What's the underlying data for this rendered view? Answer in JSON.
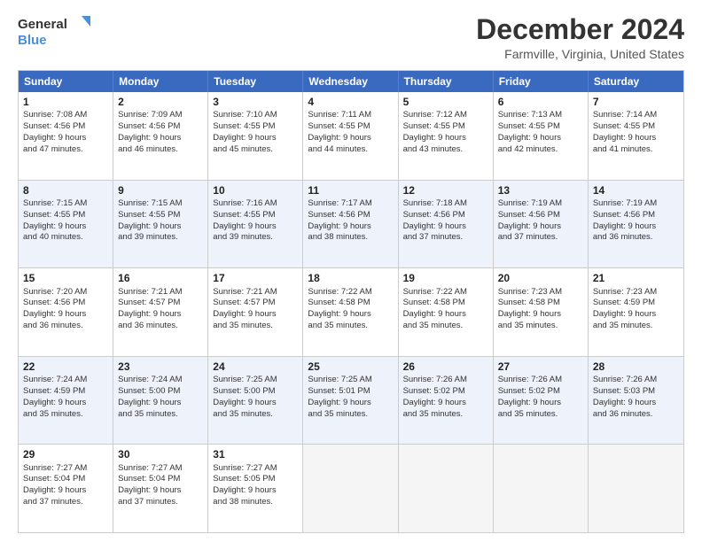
{
  "logo": {
    "line1": "General",
    "line2": "Blue"
  },
  "title": "December 2024",
  "subtitle": "Farmville, Virginia, United States",
  "days_of_week": [
    "Sunday",
    "Monday",
    "Tuesday",
    "Wednesday",
    "Thursday",
    "Friday",
    "Saturday"
  ],
  "weeks": [
    {
      "alt": false,
      "cells": [
        {
          "day": "1",
          "info": "Sunrise: 7:08 AM\nSunset: 4:56 PM\nDaylight: 9 hours\nand 47 minutes."
        },
        {
          "day": "2",
          "info": "Sunrise: 7:09 AM\nSunset: 4:56 PM\nDaylight: 9 hours\nand 46 minutes."
        },
        {
          "day": "3",
          "info": "Sunrise: 7:10 AM\nSunset: 4:55 PM\nDaylight: 9 hours\nand 45 minutes."
        },
        {
          "day": "4",
          "info": "Sunrise: 7:11 AM\nSunset: 4:55 PM\nDaylight: 9 hours\nand 44 minutes."
        },
        {
          "day": "5",
          "info": "Sunrise: 7:12 AM\nSunset: 4:55 PM\nDaylight: 9 hours\nand 43 minutes."
        },
        {
          "day": "6",
          "info": "Sunrise: 7:13 AM\nSunset: 4:55 PM\nDaylight: 9 hours\nand 42 minutes."
        },
        {
          "day": "7",
          "info": "Sunrise: 7:14 AM\nSunset: 4:55 PM\nDaylight: 9 hours\nand 41 minutes."
        }
      ]
    },
    {
      "alt": true,
      "cells": [
        {
          "day": "8",
          "info": "Sunrise: 7:15 AM\nSunset: 4:55 PM\nDaylight: 9 hours\nand 40 minutes."
        },
        {
          "day": "9",
          "info": "Sunrise: 7:15 AM\nSunset: 4:55 PM\nDaylight: 9 hours\nand 39 minutes."
        },
        {
          "day": "10",
          "info": "Sunrise: 7:16 AM\nSunset: 4:55 PM\nDaylight: 9 hours\nand 39 minutes."
        },
        {
          "day": "11",
          "info": "Sunrise: 7:17 AM\nSunset: 4:56 PM\nDaylight: 9 hours\nand 38 minutes."
        },
        {
          "day": "12",
          "info": "Sunrise: 7:18 AM\nSunset: 4:56 PM\nDaylight: 9 hours\nand 37 minutes."
        },
        {
          "day": "13",
          "info": "Sunrise: 7:19 AM\nSunset: 4:56 PM\nDaylight: 9 hours\nand 37 minutes."
        },
        {
          "day": "14",
          "info": "Sunrise: 7:19 AM\nSunset: 4:56 PM\nDaylight: 9 hours\nand 36 minutes."
        }
      ]
    },
    {
      "alt": false,
      "cells": [
        {
          "day": "15",
          "info": "Sunrise: 7:20 AM\nSunset: 4:56 PM\nDaylight: 9 hours\nand 36 minutes."
        },
        {
          "day": "16",
          "info": "Sunrise: 7:21 AM\nSunset: 4:57 PM\nDaylight: 9 hours\nand 36 minutes."
        },
        {
          "day": "17",
          "info": "Sunrise: 7:21 AM\nSunset: 4:57 PM\nDaylight: 9 hours\nand 35 minutes."
        },
        {
          "day": "18",
          "info": "Sunrise: 7:22 AM\nSunset: 4:58 PM\nDaylight: 9 hours\nand 35 minutes."
        },
        {
          "day": "19",
          "info": "Sunrise: 7:22 AM\nSunset: 4:58 PM\nDaylight: 9 hours\nand 35 minutes."
        },
        {
          "day": "20",
          "info": "Sunrise: 7:23 AM\nSunset: 4:58 PM\nDaylight: 9 hours\nand 35 minutes."
        },
        {
          "day": "21",
          "info": "Sunrise: 7:23 AM\nSunset: 4:59 PM\nDaylight: 9 hours\nand 35 minutes."
        }
      ]
    },
    {
      "alt": true,
      "cells": [
        {
          "day": "22",
          "info": "Sunrise: 7:24 AM\nSunset: 4:59 PM\nDaylight: 9 hours\nand 35 minutes."
        },
        {
          "day": "23",
          "info": "Sunrise: 7:24 AM\nSunset: 5:00 PM\nDaylight: 9 hours\nand 35 minutes."
        },
        {
          "day": "24",
          "info": "Sunrise: 7:25 AM\nSunset: 5:00 PM\nDaylight: 9 hours\nand 35 minutes."
        },
        {
          "day": "25",
          "info": "Sunrise: 7:25 AM\nSunset: 5:01 PM\nDaylight: 9 hours\nand 35 minutes."
        },
        {
          "day": "26",
          "info": "Sunrise: 7:26 AM\nSunset: 5:02 PM\nDaylight: 9 hours\nand 35 minutes."
        },
        {
          "day": "27",
          "info": "Sunrise: 7:26 AM\nSunset: 5:02 PM\nDaylight: 9 hours\nand 35 minutes."
        },
        {
          "day": "28",
          "info": "Sunrise: 7:26 AM\nSunset: 5:03 PM\nDaylight: 9 hours\nand 36 minutes."
        }
      ]
    },
    {
      "alt": false,
      "cells": [
        {
          "day": "29",
          "info": "Sunrise: 7:27 AM\nSunset: 5:04 PM\nDaylight: 9 hours\nand 37 minutes."
        },
        {
          "day": "30",
          "info": "Sunrise: 7:27 AM\nSunset: 5:04 PM\nDaylight: 9 hours\nand 37 minutes."
        },
        {
          "day": "31",
          "info": "Sunrise: 7:27 AM\nSunset: 5:05 PM\nDaylight: 9 hours\nand 38 minutes."
        },
        {
          "day": "",
          "info": ""
        },
        {
          "day": "",
          "info": ""
        },
        {
          "day": "",
          "info": ""
        },
        {
          "day": "",
          "info": ""
        }
      ]
    }
  ]
}
